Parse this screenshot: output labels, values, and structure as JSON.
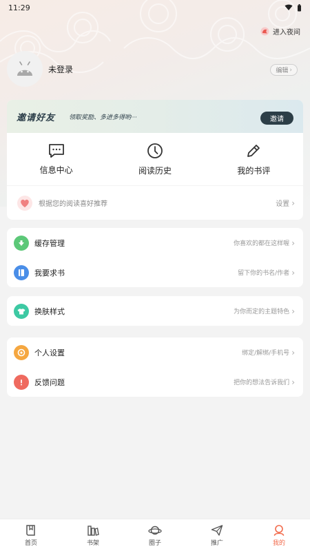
{
  "status_bar": {
    "time": "11:29"
  },
  "header": {
    "night_mode_label": "进入夜间"
  },
  "profile": {
    "username": "未登录",
    "edit_label": "编辑"
  },
  "invite": {
    "title": "邀请好友",
    "subtitle": "领取奖励、多进多得哟···",
    "button_label": "邀请"
  },
  "quick_actions": [
    {
      "label": "信息中心",
      "icon": "message-icon"
    },
    {
      "label": "阅读历史",
      "icon": "clock-icon"
    },
    {
      "label": "我的书评",
      "icon": "pencil-icon"
    }
  ],
  "recommendation": {
    "text": "根据您的阅读喜好推荐",
    "action_label": "设置"
  },
  "menu_group_1": [
    {
      "label": "缓存管理",
      "hint": "你喜欢的都在这样喔",
      "icon": "cloud-download-icon",
      "color": "#5cc878"
    },
    {
      "label": "我要求书",
      "hint": "留下你的书名/作者",
      "icon": "book-request-icon",
      "color": "#4a8ee8"
    }
  ],
  "menu_group_2": [
    {
      "label": "换肤样式",
      "hint": "为你而定的主题特色",
      "icon": "shirt-icon",
      "color": "#3dc9a3"
    }
  ],
  "menu_group_3": [
    {
      "label": "个人设置",
      "hint": "绑定/解绑/手机号",
      "icon": "settings-icon",
      "color": "#f5a740"
    },
    {
      "label": "反馈问题",
      "hint": "把你的想法告诉我们",
      "icon": "feedback-icon",
      "color": "#ef6a5f"
    }
  ],
  "tabbar": [
    {
      "label": "首页",
      "icon": "home-book-icon",
      "active": false
    },
    {
      "label": "书架",
      "icon": "bookshelf-icon",
      "active": false
    },
    {
      "label": "圈子",
      "icon": "planet-icon",
      "active": false
    },
    {
      "label": "推广",
      "icon": "paper-plane-icon",
      "active": false
    },
    {
      "label": "我的",
      "icon": "profile-icon",
      "active": true
    }
  ],
  "colors": {
    "accent": "#f26a4b",
    "background": "#f3f3f3",
    "invite_button": "#2c3e47"
  }
}
